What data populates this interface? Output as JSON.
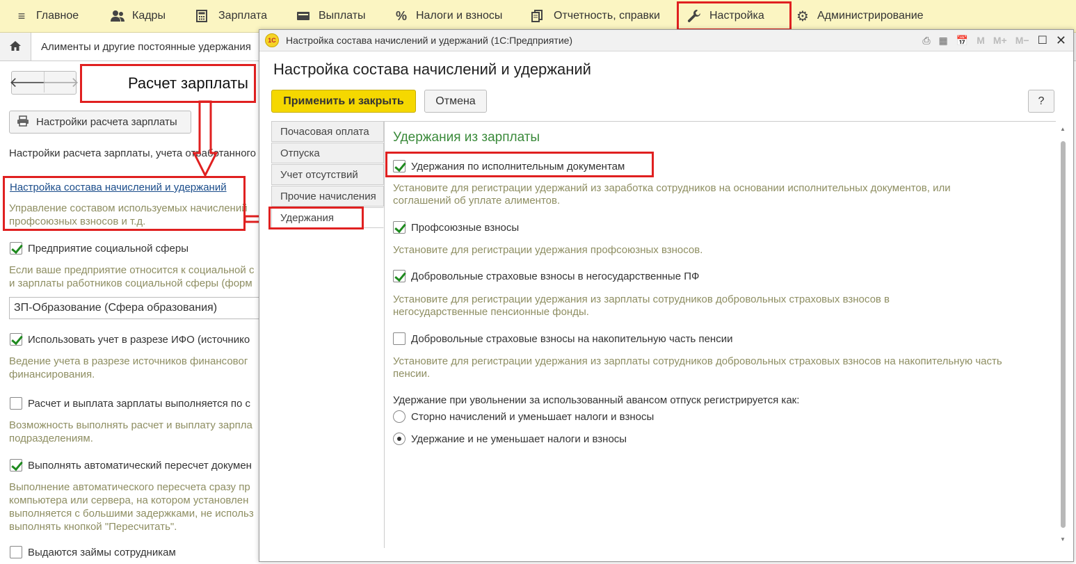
{
  "menu": {
    "items": [
      {
        "label": "Главное",
        "icon": "hamburger-icon"
      },
      {
        "label": "Кадры",
        "icon": "people-icon"
      },
      {
        "label": "Зарплата",
        "icon": "calculator-icon"
      },
      {
        "label": "Выплаты",
        "icon": "wallet-icon"
      },
      {
        "label": "Налоги и взносы",
        "icon": "percent-icon"
      },
      {
        "label": "Отчетность, справки",
        "icon": "documents-icon"
      },
      {
        "label": "Настройка",
        "icon": "wrench-icon"
      },
      {
        "label": "Администрирование",
        "icon": "gear-icon"
      }
    ]
  },
  "tabs": {
    "current_doc": "Алименты и другие постоянные удержания"
  },
  "left": {
    "annotation": "Расчет зарплаты",
    "settings_button": "Настройки расчета зарплаты",
    "intro_text": "Настройки расчета зарплаты, учета отработанного",
    "link": "Настройка состава начислений и удержаний",
    "link_desc_1": "Управление составом используемых начислений",
    "link_desc_2": "профсоюзных взносов и т.д.",
    "social_label": "Предприятие социальной сферы",
    "social_desc_1": "Если ваше предприятие относится к социальной с",
    "social_desc_2": "и зарплаты работников социальной сферы (форм",
    "select_value": "ЗП-Образование (Сфера образования)",
    "ifo_label": "Использовать учет в разрезе ИФО (источнико",
    "ifo_desc_1": "Ведение учета в разрезе источников финансовог",
    "ifo_desc_2": "финансирования.",
    "separate_label": "Расчет и выплата зарплаты выполняется по с",
    "separate_desc_1": "Возможность выполнять расчет и выплату зарпла",
    "separate_desc_2": "подразделениям.",
    "recalc_label": "Выполнять автоматический пересчет докумен",
    "recalc_desc_1": "Выполнение автоматического пересчета сразу пр",
    "recalc_desc_2": "компьютера или сервера, на котором установлен",
    "recalc_desc_3": "выполняется с большими задержками, не использ",
    "recalc_desc_4": "выполнять кнопкой \"Пересчитать\".",
    "loans_label": "Выдаются займы сотрудникам"
  },
  "dialog": {
    "window_title": "Настройка состава начислений и удержаний  (1С:Предприятие)",
    "logo_text": "1С",
    "heading": "Настройка состава начислений и удержаний",
    "apply_button": "Применить и закрыть",
    "cancel_button": "Отмена",
    "help_button": "?",
    "tabs": [
      {
        "label": "Почасовая оплата"
      },
      {
        "label": "Отпуска"
      },
      {
        "label": "Учет отсутствий"
      },
      {
        "label": "Прочие начисления"
      },
      {
        "label": "Удержания"
      }
    ],
    "active_tab": "Удержания",
    "panel": {
      "title": "Удержания из зарплаты",
      "opt1_label": "Удержания по исполнительным документам",
      "opt1_desc": "Установите для регистрации удержаний из заработка сотрудников на основании исполнительных документов, или соглашений об уплате алиментов.",
      "opt2_label": "Профсоюзные взносы",
      "opt2_desc": "Установите для регистрации удержания профсоюзных взносов.",
      "opt3_label": "Добровольные страховые взносы в негосударственные ПФ",
      "opt3_desc": "Установите для регистрации удержания из зарплаты сотрудников добровольных страховых взносов в негосударственные пенсионные фонды.",
      "opt4_label": "Добровольные страховые взносы на накопительную часть пенсии",
      "opt4_desc": "Установите для регистрации удержания из зарплаты сотрудников добровольных страховых взносов на накопительную часть пенсии.",
      "radio_caption": "Удержание при увольнении за использованный авансом отпуск регистрируется как:",
      "radio1_label": "Сторно начислений и уменьшает налоги и взносы",
      "radio2_label": "Удержание и не уменьшает налоги и взносы"
    },
    "states": {
      "opt1": true,
      "opt2": true,
      "opt3": true,
      "opt4": false,
      "radio_selected": 2
    }
  },
  "colors": {
    "menu_bg": "#fbf5c2",
    "accent_yellow": "#f5d800",
    "annotation_red": "#e02020",
    "section_green": "#3a8a3a",
    "hint_text": "#8e8e62",
    "link_blue": "#1a4c8a"
  }
}
